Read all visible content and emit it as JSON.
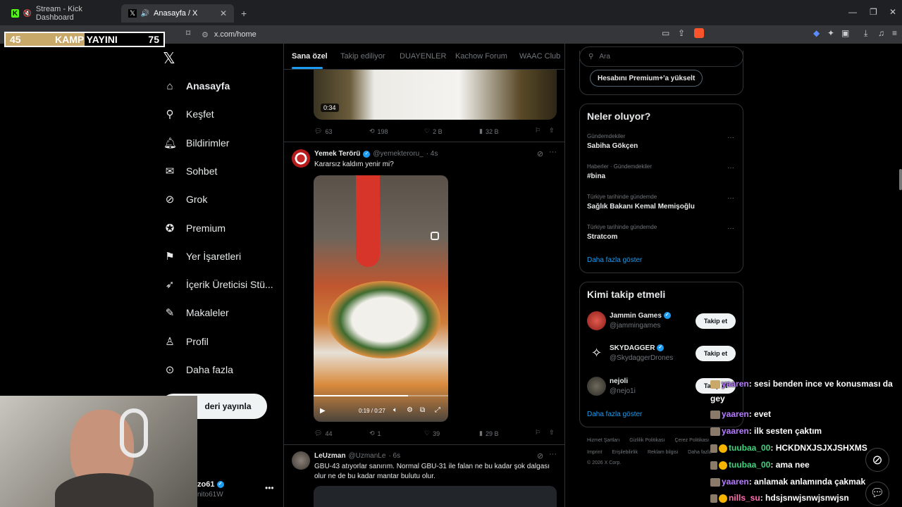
{
  "browser": {
    "tabs": [
      {
        "label": "Stream - Kick Dashboard"
      },
      {
        "label": "Anasayfa / X"
      }
    ],
    "url": "x.com/home"
  },
  "overlay": {
    "left_num": "45",
    "title": "KAMP YAYINI",
    "right_num": "75"
  },
  "nav": {
    "items": [
      {
        "label": "Anasayfa"
      },
      {
        "label": "Keşfet"
      },
      {
        "label": "Bildirimler"
      },
      {
        "label": "Sohbet"
      },
      {
        "label": "Grok"
      },
      {
        "label": "Premium"
      },
      {
        "label": "Yer İşaretleri"
      },
      {
        "label": "İçerik Üreticisi Stü..."
      },
      {
        "label": "Makaleler"
      },
      {
        "label": "Profil"
      },
      {
        "label": "Daha fazla"
      }
    ],
    "post_button": "deri yayınla",
    "account_name": "zo61",
    "account_handle": "nito61W"
  },
  "feed": {
    "tabs": [
      "Sana özel",
      "Takip ediliyor",
      "DUAYENLER",
      "Kachow Forum",
      "WAAC Club"
    ],
    "prev": {
      "video_time": "0:34",
      "replies": "63",
      "reposts": "198",
      "likes": "2 B",
      "views": "32 B"
    },
    "posts": [
      {
        "name": "Yemek Terörü",
        "handle": "@yemekteroru_",
        "time": "· 4s",
        "text": "Kararsız kaldım yenir mi?",
        "video_time": "0:19 / 0:27",
        "replies": "44",
        "reposts": "1",
        "likes": "39",
        "views": "29 B"
      },
      {
        "name": "LeUzman",
        "handle": "@UzmanLe",
        "time": "· 6s",
        "text": "GBU-43 atıyorlar sanırım. Normal GBU-31 ile falan ne bu kadar şok dalgası olur ne de bu kadar mantar bulutu olur."
      }
    ]
  },
  "sidebar": {
    "search_placeholder": "Ara",
    "premium_button": "Hesabını Premium+'a yükselt",
    "trends_title": "Neler oluyor?",
    "trends": [
      {
        "meta": "Gündemdekiler",
        "title": "Sabiha Gökçen"
      },
      {
        "meta": "Haberler · Gündemdekiler",
        "title": "#bina"
      },
      {
        "meta": "Türkiye tarihinde gündemde",
        "title": "Sağlık Bakanı Kemal Memişoğlu"
      },
      {
        "meta": "Türkiye tarihinde gündemde",
        "title": "Stratcom"
      }
    ],
    "trends_more": "Daha fazla göster",
    "who_title": "Kimi takip etmeli",
    "who": [
      {
        "name": "Jammin Games",
        "handle": "@jammingames",
        "button": "Takip et"
      },
      {
        "name": "SKYDAGGER",
        "handle": "@SkydaggerDrones",
        "button": "Takip et"
      },
      {
        "name": "nejoli",
        "handle": "@nejo1i",
        "button": "Takip et"
      }
    ],
    "who_more": "Daha fazla göster",
    "footer": {
      "l1": [
        "Hizmet Şartları",
        "Gizlilik Politikası",
        "Çerez Politikası"
      ],
      "l2": [
        "Imprint",
        "Erişilebilirlik",
        "Reklam bilgisi",
        "Daha fazla"
      ],
      "copy": "© 2026 X Corp."
    }
  },
  "chat": [
    {
      "user": "yaaren",
      "msg": ": sesi benden ince ve konusması da",
      "color": "#b77cff"
    },
    {
      "user": "",
      "msg": "gey",
      "color": "#ffffff"
    },
    {
      "user": "yaaren",
      "msg": ": evet",
      "color": "#b77cff"
    },
    {
      "user": "yaaren",
      "msg": ": ilk sesten çaktım",
      "color": "#b77cff"
    },
    {
      "user": "tuubaa_00",
      "msg": ": HCKDNXJSJXJSHXMS",
      "color": "#3fd47d"
    },
    {
      "user": "tuubaa_00",
      "msg": ": ama nee",
      "color": "#3fd47d"
    },
    {
      "user": "yaaren",
      "msg": ": anlamak anlamında çakmak",
      "color": "#b77cff"
    },
    {
      "user": "nills_su",
      "msg": ": hdsjsnwjsnwjsnwjsn",
      "color": "#ff6fb0"
    }
  ]
}
